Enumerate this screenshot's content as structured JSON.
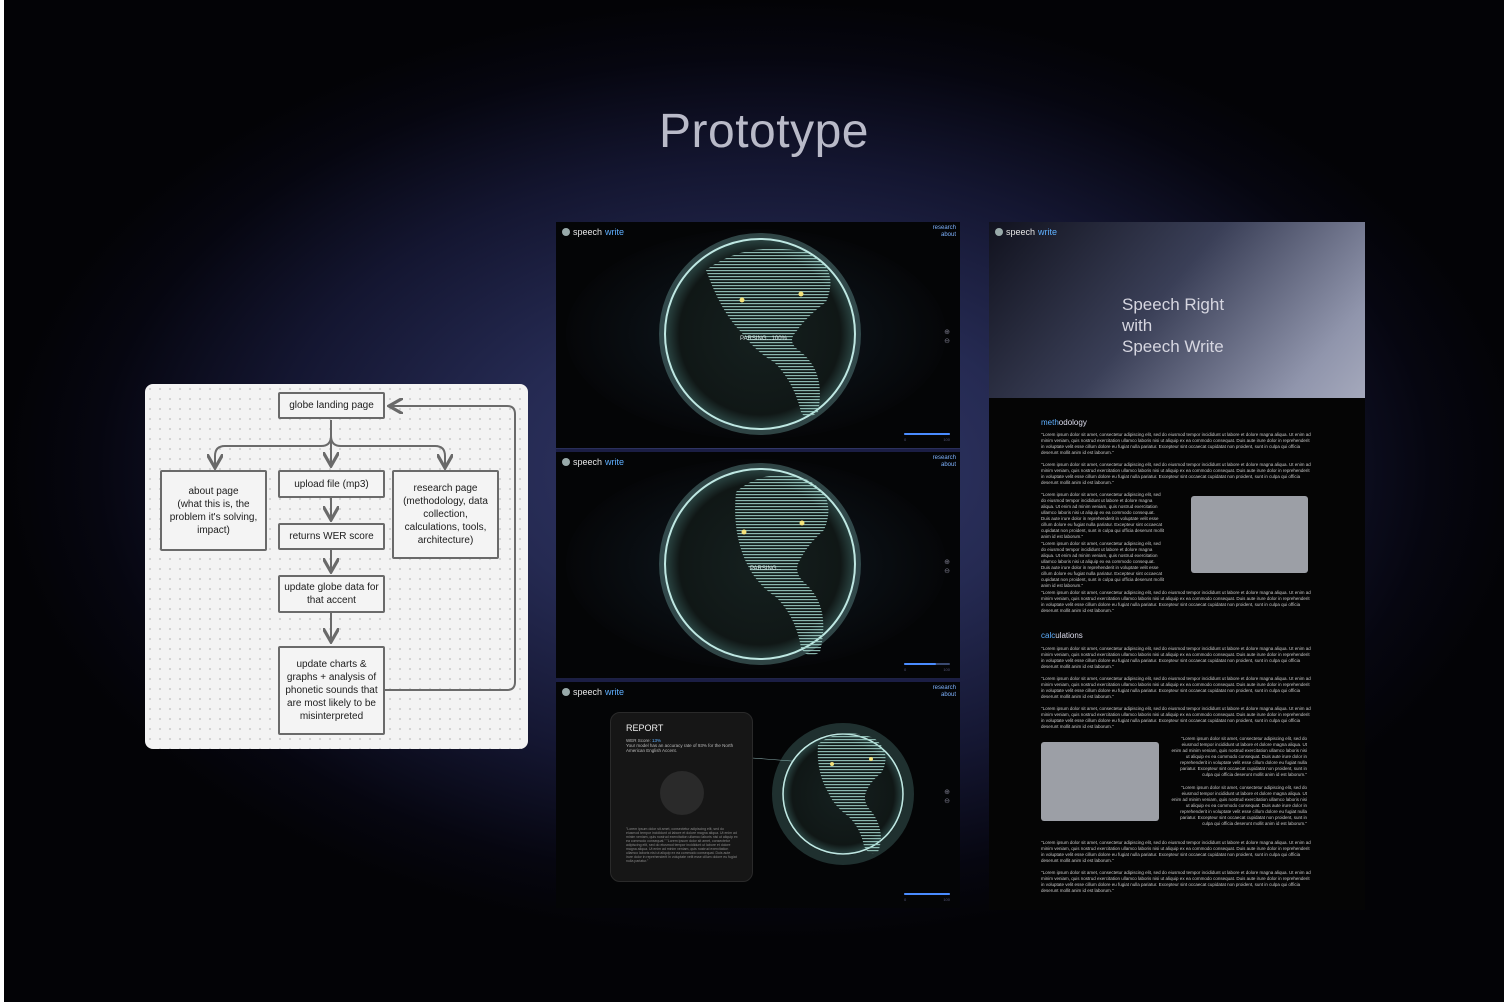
{
  "page": {
    "title": "Prototype"
  },
  "flowchart": {
    "nodes": {
      "landing": "globe landing page",
      "about": "about page\n(what this is, the problem it's solving, impact)",
      "upload": "upload file (mp3)",
      "wer": "returns WER score",
      "research": "research page\n(methodology, data collection, calculations, tools, architecture)",
      "update_globe": "update globe data for that accent",
      "update_charts": "update charts & graphs + analysis of phonetic sounds that are most likely to be misinterpreted"
    }
  },
  "brand": {
    "prefix": "speech",
    "suffix": "write"
  },
  "nav": {
    "research": "research",
    "about": "about"
  },
  "globe_screen_1": {
    "status": "PARSING...100%"
  },
  "globe_screen_2": {
    "status": "PARSING..."
  },
  "report": {
    "title": "REPORT",
    "wer_label": "WER Score:",
    "wer_value": "13%",
    "summary": "Your model has an accuracy rate of 93% for the North American English Accent.",
    "body": "\"Lorem ipsum dolor sit amet, consectetur adipiscing elit, sed do eiusmod tempor incididunt ut labore et dolore magna aliqua. Ut enim ad minim veniam, quis nostrud exercitation ullamco laboris nisi ut aliquip ex ea commodo consequat.\" \"Lorem ipsum dolor sit amet, consectetur adipiscing elit, sed do eiusmod tempor incididunt ut labore et dolore magna aliqua. Ut enim ad minim veniam, quis nostrud exercitation ullamco laboris nisi ut aliquip ex ea commodo consequat. Duis aute irure dolor in reprehenderit in voluptate velit esse cillum dolore eu fugiat nulla pariatur.\""
  },
  "research_page": {
    "hero_title": "Speech Right\nwith\nSpeech Write",
    "section_methodology": {
      "accent": "meth",
      "rest": "odology"
    },
    "section_calculations": {
      "accent": "calc",
      "rest": "ulations"
    },
    "lorem": "\"Lorem ipsum dolor sit amet, consectetur adipiscing elit, sed do eiusmod tempor incididunt ut labore et dolore magna aliqua. Ut enim ad minim veniam, quis nostrud exercitation ullamco laboris nisi ut aliquip ex ea commodo consequat. Duis aute irure dolor in reprehenderit in voluptate velit esse cillum dolore eu fugiat nulla pariatur. Excepteur sint occaecat cupidatat non proident, sunt in culpa qui officia deserunt mollit anim id est laborum.\"",
    "lorem_short": "\"Lorem ipsum dolor sit amet, consectetur adipiscing elit, sed do eiusmod tempor incididunt ut labore et dolore magna aliqua. Ut enim ad minim veniam, quis nostrud exercitation ullamco laboris nisi ut aliquip ex ea commodo consequat. Duis aute irure dolor in reprehenderit in voluptate velit esse cillum dolore eu fugiat nulla pariatur. Excepteur sint occaecat cupidatat non proident, sunt in culpa qui officia deserunt mollit anim id est laborum.\""
  },
  "colors": {
    "accent": "#5fb0ff",
    "globe_glow": "#a9d8d4",
    "land": "#9fd1c8"
  }
}
